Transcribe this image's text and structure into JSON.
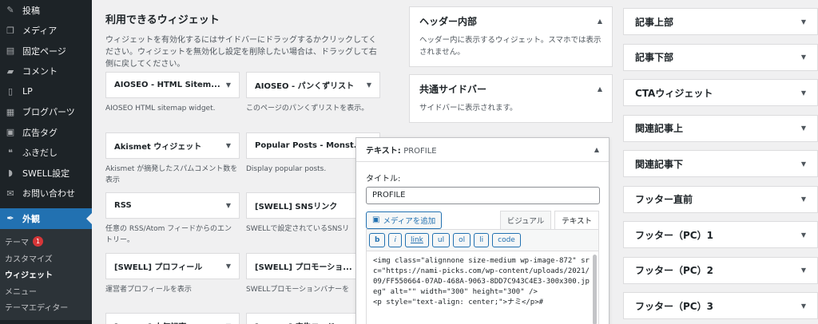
{
  "sidebar": {
    "items": [
      {
        "label": "投稿",
        "icon": "pin-icon",
        "glyph": "✎"
      },
      {
        "label": "メディア",
        "icon": "media-icon",
        "glyph": "❐"
      },
      {
        "label": "固定ページ",
        "icon": "page-icon",
        "glyph": "▤"
      },
      {
        "label": "コメント",
        "icon": "comment-icon",
        "glyph": "▰"
      },
      {
        "label": "LP",
        "icon": "lp-icon",
        "glyph": "▯"
      },
      {
        "label": "ブログパーツ",
        "icon": "blocks-icon",
        "glyph": "▦"
      },
      {
        "label": "広告タグ",
        "icon": "ad-icon",
        "glyph": "▣"
      },
      {
        "label": "ふきだし",
        "icon": "bubble-icon",
        "glyph": "❝"
      },
      {
        "label": "SWELL設定",
        "icon": "swell-icon",
        "glyph": "◗"
      },
      {
        "label": "お問い合わせ",
        "icon": "mail-icon",
        "glyph": "✉"
      }
    ],
    "active": {
      "label": "外観",
      "icon": "appearance-icon",
      "glyph": "✒"
    },
    "submenu": [
      {
        "label": "テーマ",
        "badge": "1"
      },
      {
        "label": "カスタマイズ"
      },
      {
        "label": "ウィジェット"
      },
      {
        "label": "メニュー"
      },
      {
        "label": "テーマエディター"
      }
    ]
  },
  "available": {
    "title": "利用できるウィジェット",
    "description": "ウィジェットを有効化するにはサイドバーにドラッグするかクリックしてください。ウィジェットを無効化し設定を削除したい場合は、ドラッグして右側に戻してください。",
    "widgets": [
      {
        "title": "AIOSEO - HTML Sitem...",
        "desc": "AIOSEO HTML sitemap widget."
      },
      {
        "title": "AIOSEO - パンくずリスト",
        "desc": "このページのパンくずリストを表示。"
      },
      {
        "title": "Akismet ウィジェット",
        "desc": "Akismet が摘発したスパムコメント数を表示"
      },
      {
        "title": "Popular Posts - Monst...",
        "desc": "Display popular posts."
      },
      {
        "title": "RSS",
        "desc": "任意の RSS/Atom フィードからのエントリー。"
      },
      {
        "title": "[SWELL] SNSリンク",
        "desc": "SWELLで設定されているSNSリ"
      },
      {
        "title": "[SWELL] プロフィール",
        "desc": "運営者プロフィールを表示"
      },
      {
        "title": "[SWELL] プロモーショ...",
        "desc": "SWELLプロモーションバナーを"
      },
      {
        "title": "[SWELL] 人気記事",
        "desc": ""
      },
      {
        "title": "[SWELL] 広告コード",
        "desc": ""
      }
    ]
  },
  "areas": [
    {
      "title": "ヘッダー内部",
      "desc": "ヘッダー内に表示するウィジェット。スマホでは表示されません。"
    },
    {
      "title": "共通サイドバー",
      "desc": "サイドバーに表示されます。"
    }
  ],
  "right_areas": [
    "記事上部",
    "記事下部",
    "CTAウィジェット",
    "関連記事上",
    "関連記事下",
    "フッター直前",
    "フッター（PC）1",
    "フッター（PC）2",
    "フッター（PC）3"
  ],
  "editor": {
    "header_label": "テキスト:",
    "header_title": "PROFILE",
    "title_label": "タイトル:",
    "title_value": "PROFILE",
    "media_button": "メディアを追加",
    "tab_visual": "ビジュアル",
    "tab_text": "テキスト",
    "quicktags": [
      "b",
      "i",
      "link",
      "ul",
      "ol",
      "li",
      "code"
    ],
    "code": "<img class=\"alignnone size-medium wp-image-872\" src=\"https://nami-picks.com/wp-content/uploads/2021/09/FF550664-07AD-468A-9063-8DD7C943C4E3-300x300.jpeg\" alt=\"\" width=\"300\" height=\"300\" />\n<p style=\"text-align: center;\">ナミ</p>#"
  }
}
